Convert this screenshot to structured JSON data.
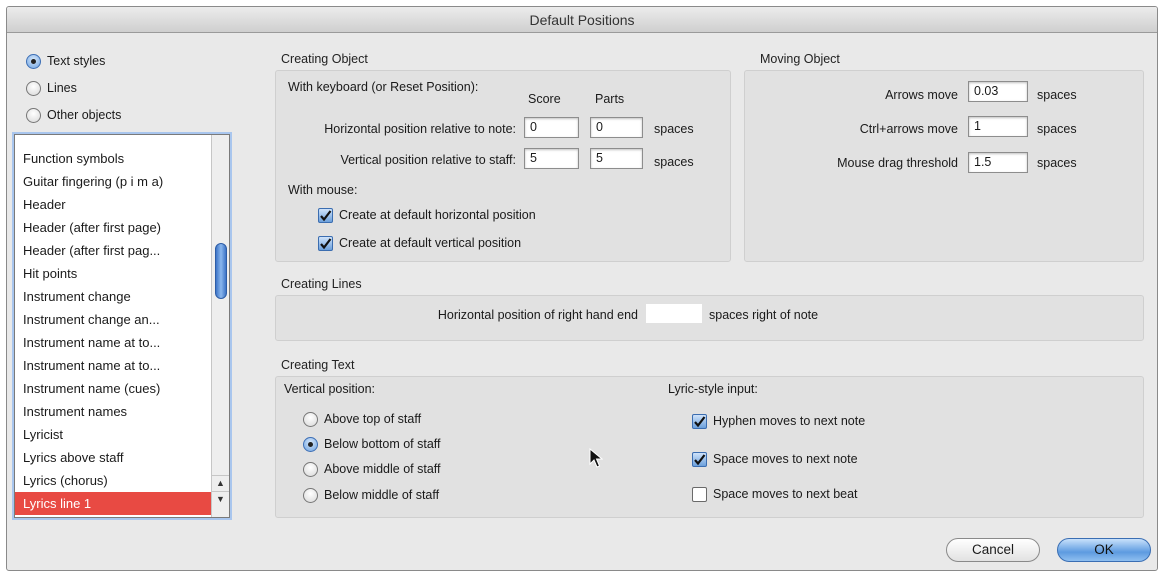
{
  "window": {
    "title": "Default Positions"
  },
  "sidebar": {
    "radios": [
      {
        "label": "Text styles",
        "selected": true
      },
      {
        "label": "Lines",
        "selected": false
      },
      {
        "label": "Other objects",
        "selected": false
      }
    ],
    "list_items": [
      "Function symbols",
      "Guitar fingering (p i m a)",
      "Header",
      "Header (after first page)",
      "Header (after first pag...",
      "Hit points",
      "Instrument change",
      "Instrument change an...",
      "Instrument name at to...",
      "Instrument name at to...",
      "Instrument name (cues)",
      "Instrument names",
      "Lyricist",
      "Lyrics above staff",
      "Lyrics (chorus)",
      "Lyrics line 1"
    ],
    "selected_item": "Lyrics line 1"
  },
  "creating_object": {
    "title": "Creating Object",
    "keyboard_label": "With keyboard (or Reset Position):",
    "col_score": "Score",
    "col_parts": "Parts",
    "horiz_label": "Horizontal position relative to note:",
    "horiz_score": "0",
    "horiz_parts": "0",
    "vert_label": "Vertical position relative to staff:",
    "vert_score": "5",
    "vert_parts": "5",
    "units": "spaces",
    "mouse_label": "With mouse:",
    "check_horiz": "Create at default horizontal position",
    "check_vert": "Create at default vertical position"
  },
  "moving_object": {
    "title": "Moving Object",
    "arrows_label": "Arrows move",
    "arrows_value": "0.03",
    "ctrl_label": "Ctrl+arrows move",
    "ctrl_value": "1",
    "drag_label": "Mouse drag threshold",
    "drag_value": "1.5",
    "units": "spaces"
  },
  "creating_lines": {
    "title": "Creating Lines",
    "label": "Horizontal position of right hand end",
    "value": "",
    "suffix": "spaces right of note"
  },
  "creating_text": {
    "title": "Creating Text",
    "vertical_label": "Vertical position:",
    "options": [
      {
        "label": "Above top of staff",
        "selected": false
      },
      {
        "label": "Below bottom of staff",
        "selected": true
      },
      {
        "label": "Above middle of staff",
        "selected": false
      },
      {
        "label": "Below middle of staff",
        "selected": false
      }
    ],
    "lyric_label": "Lyric-style input:",
    "lyric_checks": [
      {
        "label": "Hyphen moves to next note",
        "checked": true
      },
      {
        "label": "Space moves to next note",
        "checked": true
      },
      {
        "label": "Space moves to next beat",
        "checked": false
      }
    ]
  },
  "buttons": {
    "cancel": "Cancel",
    "ok": "OK"
  }
}
